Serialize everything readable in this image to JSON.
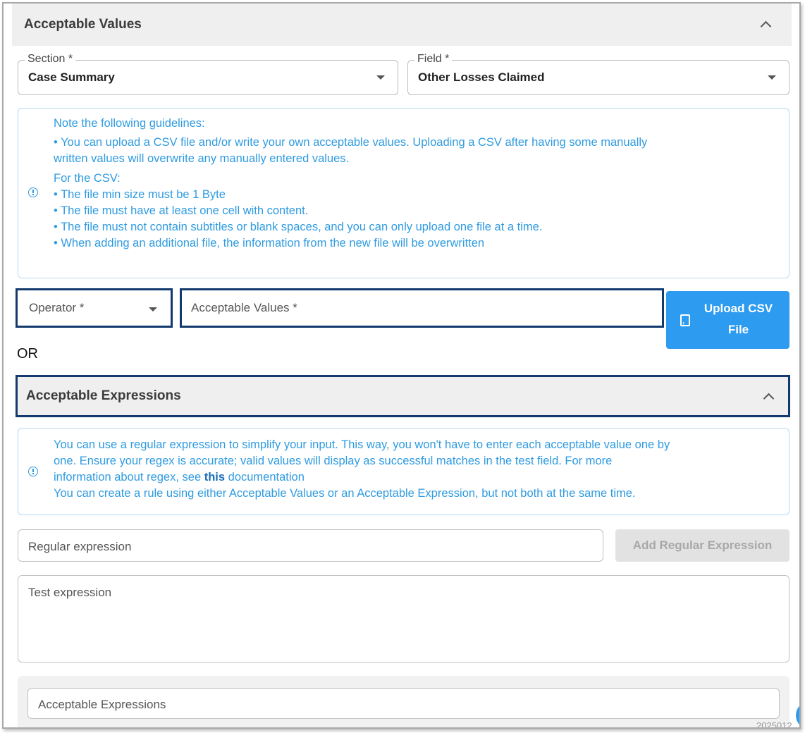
{
  "values_panel": {
    "title": "Acceptable Values",
    "section": {
      "label": "Section *",
      "value": "Case Summary"
    },
    "field": {
      "label": "Field *",
      "value": "Other Losses Claimed"
    },
    "guidelines": {
      "heading": "Note the following guidelines:",
      "line1": "• You can upload a CSV file and/or write your own acceptable values. Uploading a CSV after having some manually",
      "line1b": "written values will overwrite any manually entered values.",
      "csv_heading": "For the CSV:",
      "rules": [
        "• The file min size must be 1 Byte",
        "• The file must have at least one cell with content.",
        "• The file must not contain subtitles or blank spaces, and you can only upload one file at a time.",
        "• When adding an additional file, the information from the new file will be overwritten"
      ]
    },
    "operator_placeholder": "Operator *",
    "acceptable_values_placeholder": "Acceptable Values *",
    "upload_line1": "Upload CSV",
    "upload_line2": "File"
  },
  "or_text": "OR",
  "expressions_panel": {
    "title": "Acceptable Expressions",
    "info_line1": "You can use a regular expression to simplify your input. This way, you won't have to enter each acceptable value one by",
    "info_line2": "one. Ensure your regex is accurate; valid values will display as successful matches in the test field. For more",
    "info_line3_pre": "information about regex, see ",
    "info_link": "this",
    "info_line3_post": " documentation",
    "info_line4": "You can create a rule using either Acceptable Values or an Acceptable Expression, but not both at the same time.",
    "regex_placeholder": "Regular expression",
    "add_button": "Add Regular Expression",
    "test_placeholder": "Test expression",
    "expressions_placeholder": "Acceptable Expressions",
    "footer_text": "2025012"
  },
  "colors": {
    "accent_blue": "#2d9bf0",
    "info_blue": "#2f9be0",
    "highlight_navy": "#123a6e"
  }
}
